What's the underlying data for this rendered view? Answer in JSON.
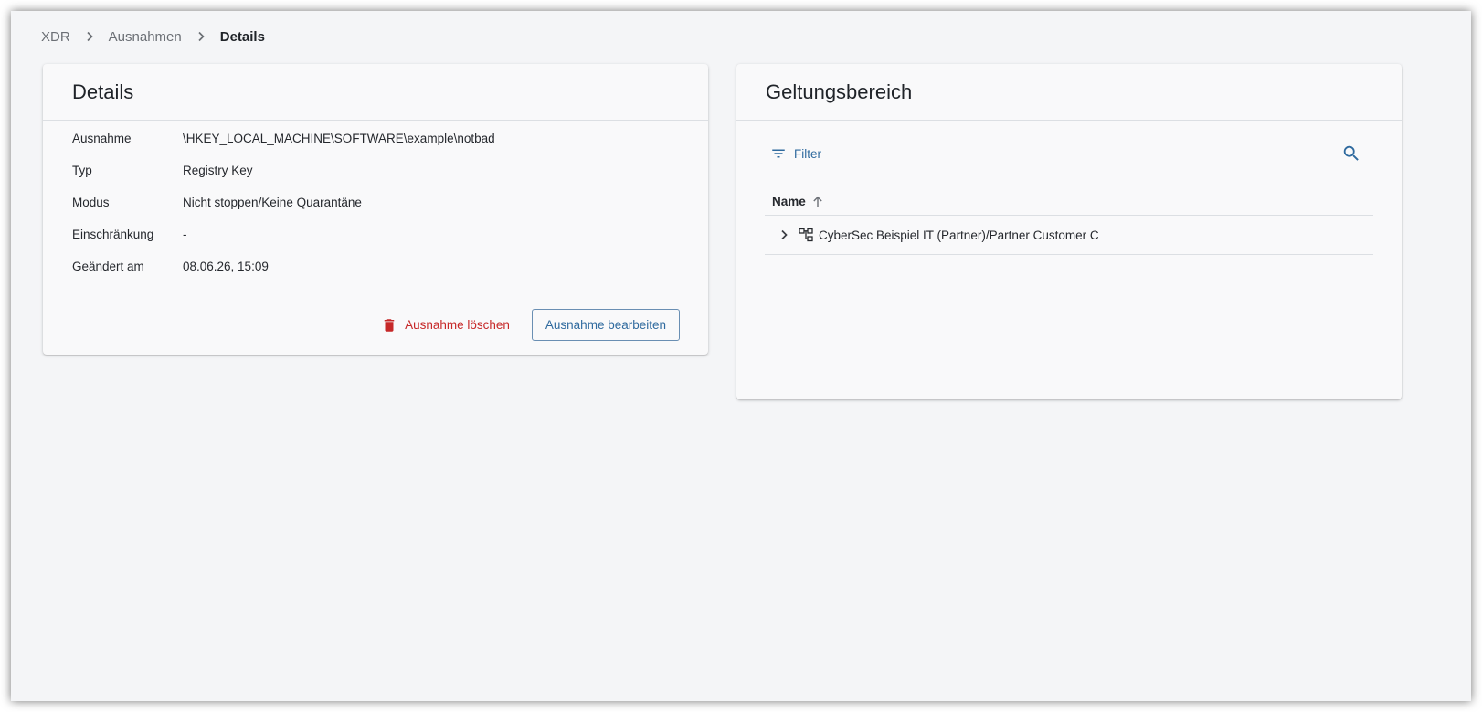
{
  "breadcrumb": {
    "items": [
      "XDR",
      "Ausnahmen"
    ],
    "current": "Details"
  },
  "details": {
    "title": "Details",
    "rows": [
      {
        "label": "Ausnahme",
        "value": "\\HKEY_LOCAL_MACHINE\\SOFTWARE\\example\\notbad"
      },
      {
        "label": "Typ",
        "value": "Registry Key"
      },
      {
        "label": "Modus",
        "value": "Nicht stoppen/Keine Quarantäne"
      },
      {
        "label": "Einschränkung",
        "value": "-"
      },
      {
        "label": "Geändert am",
        "value": "08.06.26, 15:09"
      }
    ],
    "delete_label": "Ausnahme löschen",
    "edit_label": "Ausnahme bearbeiten"
  },
  "scope": {
    "title": "Geltungsbereich",
    "filter_label": "Filter",
    "column_name": "Name",
    "rows": [
      {
        "name": "CyberSec Beispiel IT (Partner)/Partner Customer C"
      }
    ]
  },
  "colors": {
    "accent": "#2f6a9e",
    "danger": "#c62828",
    "background": "#f4f5f7",
    "card": "#f9f9fa"
  },
  "icons": {
    "breadcrumb_separator": "chevron-right-icon",
    "delete": "trash-icon",
    "filter": "filter-icon",
    "search": "search-icon",
    "sort": "arrow-up-icon",
    "expand": "chevron-right-icon",
    "org": "org-tree-icon"
  }
}
